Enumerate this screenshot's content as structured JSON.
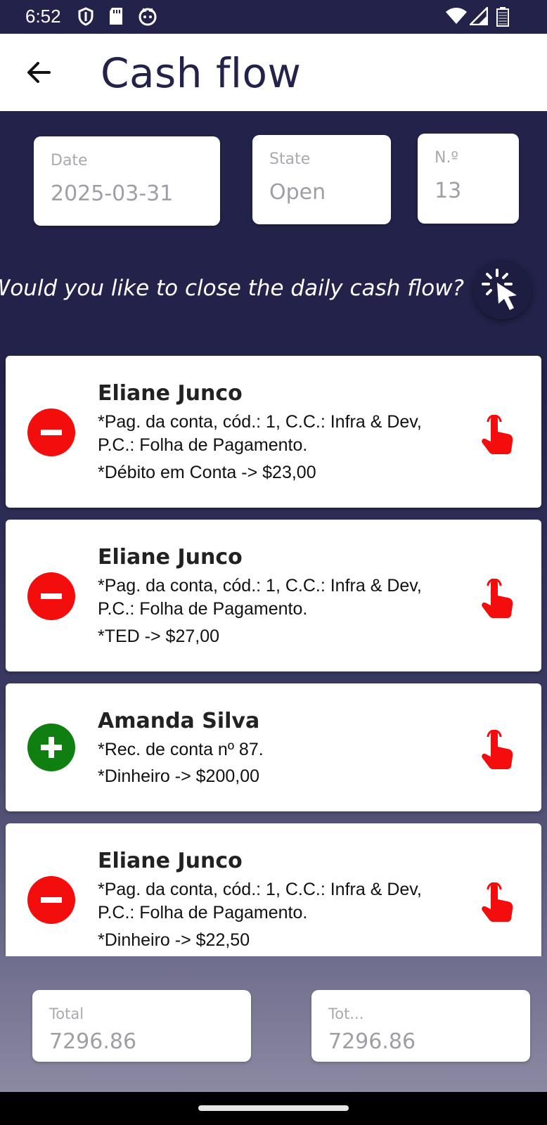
{
  "status_bar": {
    "time": "6:52",
    "left_icons": [
      "shield-icon",
      "sd-card-icon",
      "cat-icon"
    ],
    "right_icons": [
      "wifi-icon",
      "signal-icon",
      "battery-icon"
    ]
  },
  "app_bar": {
    "title": "Cash flow",
    "back_icon": "arrow-left-icon"
  },
  "header_fields": {
    "date": {
      "label": "Date",
      "value": "2025-03-31"
    },
    "state": {
      "label": "State",
      "value": "Open"
    },
    "number": {
      "label": "N.º",
      "value": "13"
    }
  },
  "prompt": {
    "text": "Would you like to close the daily cash flow?",
    "action_icon": "click-pointer-icon"
  },
  "entries": [
    {
      "type": "debit",
      "name": "Eliane Junco",
      "description": "*Pag. da conta, cód.: 1, C.C.: Infra & Dev, P.C.: Folha de Pagamento.",
      "payment": "*Débito em Conta ->  $23,00"
    },
    {
      "type": "debit",
      "name": "Eliane Junco",
      "description": "*Pag. da conta, cód.: 1, C.C.: Infra & Dev, P.C.: Folha de Pagamento.",
      "payment": "*TED ->  $27,00"
    },
    {
      "type": "credit",
      "name": "Amanda Silva",
      "description": "*Rec. de conta nº 87.",
      "payment": "*Dinheiro ->  $200,00"
    },
    {
      "type": "debit",
      "name": "Eliane Junco",
      "description": "*Pag. da conta, cód.: 1, C.C.: Infra & Dev, P.C.: Folha de Pagamento.",
      "payment": "*Dinheiro ->  $22,50"
    }
  ],
  "footer": {
    "total": {
      "label": "Total",
      "value": "7296.86"
    },
    "total2": {
      "label": "Tot...",
      "value": "7296.86"
    }
  },
  "colors": {
    "primary": "#22224a",
    "debit": "#f40d0d",
    "credit": "#0f7f12",
    "tap_icon": "#f40d0d"
  }
}
